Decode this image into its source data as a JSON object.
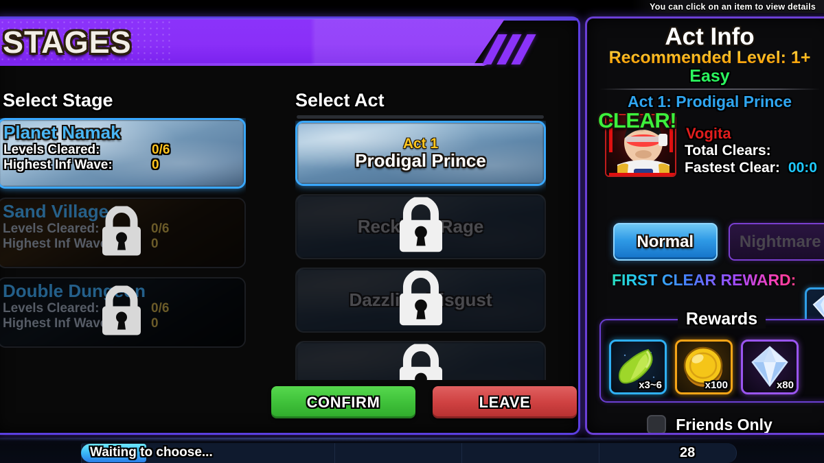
{
  "tooltip": {
    "text": "You can click on an item to view details"
  },
  "header": {
    "title": "STAGES"
  },
  "columns": {
    "stage_heading": "Select Stage",
    "act_heading": "Select Act"
  },
  "stages": [
    {
      "name": "Planet Namak",
      "levels_label": "Levels Cleared:",
      "levels_value": "0/6",
      "wave_label": "Highest Inf Wave:",
      "wave_value": "0",
      "locked": false,
      "selected": true
    },
    {
      "name": "Sand Village",
      "levels_label": "Levels Cleared:",
      "levels_value": "0/6",
      "wave_label": "Highest Inf Wave:",
      "wave_value": "0",
      "locked": true,
      "selected": false
    },
    {
      "name": "Double Dungeon",
      "levels_label": "Levels Cleared:",
      "levels_value": "0/6",
      "wave_label": "Highest Inf Wave:",
      "wave_value": "0",
      "locked": true,
      "selected": false
    }
  ],
  "acts": [
    {
      "number": "Act 1",
      "name": "Prodigal Prince",
      "locked": false,
      "selected": true
    },
    {
      "number": "",
      "name": "Reckless Rage",
      "locked": true,
      "selected": false
    },
    {
      "number": "",
      "name": "Dazzling Disgust",
      "locked": true,
      "selected": false
    },
    {
      "number": "",
      "name": "",
      "locked": true,
      "selected": false
    }
  ],
  "buttons": {
    "confirm": "CONFIRM",
    "leave": "LEAVE"
  },
  "act_info": {
    "title": "Act Info",
    "recommended_level": "Recommended Level: 1+",
    "difficulty": "Easy",
    "act_subtitle": "Act 1: Prodigal Prince",
    "clear_stamp": "CLEAR!",
    "boss_name": "Vogita",
    "total_clears_label": "Total Clears:",
    "total_clears_value": "",
    "fastest_clear_label": "Fastest Clear:",
    "fastest_clear_value": "00:0",
    "difficulty_buttons": {
      "normal": "Normal",
      "nightmare": "Nightmare"
    },
    "first_clear_reward_label": "FIRST CLEAR REWARD:",
    "rewards_title": "Rewards",
    "rewards": [
      {
        "item": "senzu-bean",
        "qty": "x3~6",
        "border_color": "#2fb0f5"
      },
      {
        "item": "gold-coin",
        "qty": "x100",
        "border_color": "#f5a417"
      },
      {
        "item": "gem",
        "qty": "x80",
        "border_color": "#9a55f0"
      }
    ],
    "friends_only_label": "Friends Only",
    "friends_only_checked": false
  },
  "bottom_bar": {
    "status": "Waiting to choose...",
    "player_count": "28"
  },
  "colors": {
    "banner_purple": "#8b33fa",
    "panel_border": "#6b3fd6",
    "select_blue": "#3aa8ff",
    "stage_name_blue": "#49b6f5",
    "gold": "#ffc41f",
    "green": "#2bf55e",
    "boss_red": "#e11d1d",
    "cyan": "#1ec8ff"
  }
}
